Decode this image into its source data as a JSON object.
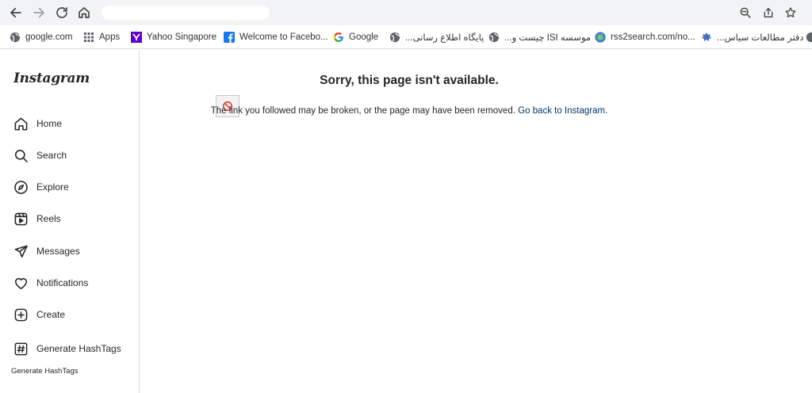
{
  "browser": {
    "bookmarks": [
      {
        "label": "google.com",
        "icon": "globe-icon"
      },
      {
        "label": "Apps",
        "icon": "apps-grid-icon"
      },
      {
        "label": "Yahoo Singapore",
        "icon": "yahoo-icon"
      },
      {
        "label": "Welcome to Facebo...",
        "icon": "facebook-icon"
      },
      {
        "label": "Google",
        "icon": "google-icon"
      },
      {
        "label": "پایگاه اطلاع رسانی...",
        "icon": "globe-icon"
      },
      {
        "label": "موسسه ISI چیست و...",
        "icon": "globe-icon"
      },
      {
        "label": "rss2search.com/no...",
        "icon": "globe-icon"
      },
      {
        "label": "دفتر مطالعات سیاس...",
        "icon": "emblem-icon"
      }
    ]
  },
  "sidebar": {
    "logo": "Instagram",
    "items": [
      {
        "label": "Home",
        "icon": "home-icon"
      },
      {
        "label": "Search",
        "icon": "search-icon"
      },
      {
        "label": "Explore",
        "icon": "compass-icon"
      },
      {
        "label": "Reels",
        "icon": "reels-icon"
      },
      {
        "label": "Messages",
        "icon": "paper-plane-icon"
      },
      {
        "label": "Notifications",
        "icon": "heart-icon"
      },
      {
        "label": "Create",
        "icon": "plus-square-icon"
      },
      {
        "label": "Generate HashTags",
        "icon": "hashtag-icon"
      }
    ],
    "sub_label": "Generate HashTags"
  },
  "main": {
    "error_title": "Sorry, this page isn't available.",
    "error_message": "The link you followed may be broken, or the page may have been removed.",
    "back_link": "Go back to Instagram."
  },
  "colors": {
    "link": "#00376b",
    "chrome_bg": "#f1f3f4",
    "border": "#dbdbdb"
  }
}
